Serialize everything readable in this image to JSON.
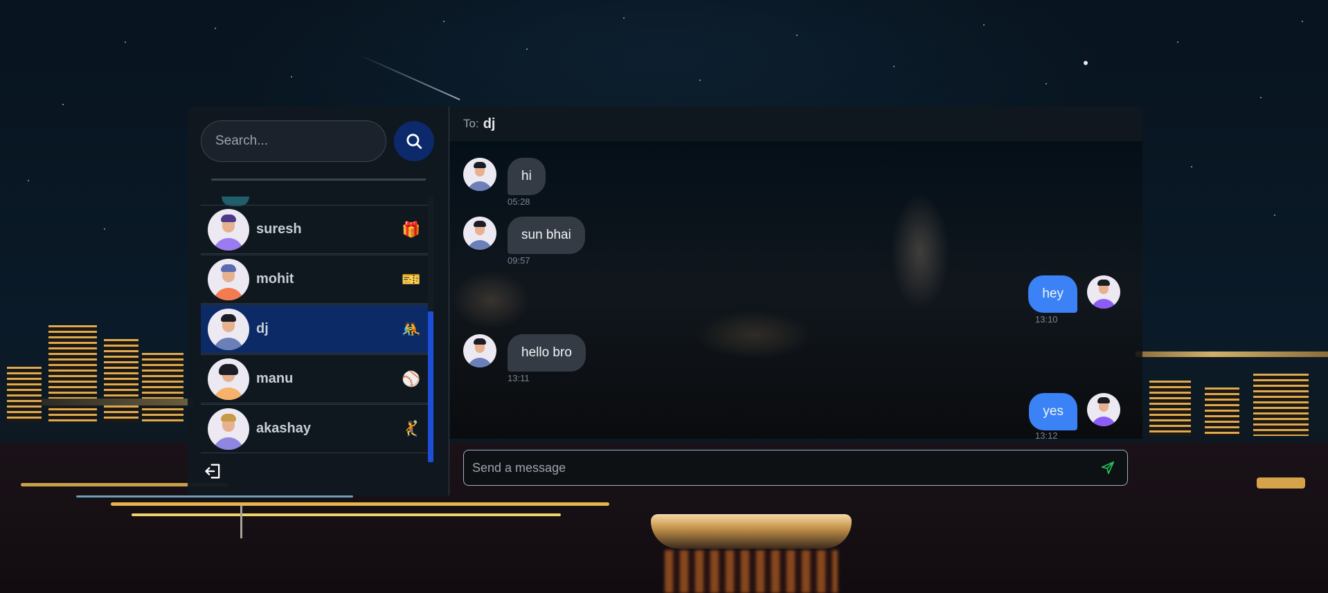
{
  "search": {
    "placeholder": "Search..."
  },
  "contacts": [
    {
      "name": "suresh",
      "emoji": "🎁",
      "avatar_color": "#9b7bf0",
      "active": false
    },
    {
      "name": "mohit",
      "emoji": "🎫",
      "avatar_color": "#f47a4f",
      "active": false
    },
    {
      "name": "dj",
      "emoji": "🤼",
      "avatar_color": "#6b7fb8",
      "active": true
    },
    {
      "name": "manu",
      "emoji": "⚾",
      "avatar_color": "#f6b26b",
      "active": false
    },
    {
      "name": "akashay",
      "emoji": "🤾",
      "avatar_color": "#8f86e0",
      "active": false
    }
  ],
  "chat": {
    "to_label": "To:",
    "recipient": "dj",
    "messages": [
      {
        "text": "hi",
        "time": "05:28",
        "direction": "in"
      },
      {
        "text": "sun bhai",
        "time": "09:57",
        "direction": "in"
      },
      {
        "text": "hey",
        "time": "13:10",
        "direction": "out"
      },
      {
        "text": "hello bro",
        "time": "13:11",
        "direction": "in"
      },
      {
        "text": "yes",
        "time": "13:12",
        "direction": "out"
      }
    ]
  },
  "composer": {
    "placeholder": "Send a message"
  },
  "icons": {
    "search": "search-icon",
    "logout": "logout-icon",
    "send": "send-icon"
  },
  "colors": {
    "accent": "#3b82f6",
    "active_contact": "#0b2a66",
    "search_button": "#0c2a6b",
    "send_icon": "#22c55e"
  }
}
